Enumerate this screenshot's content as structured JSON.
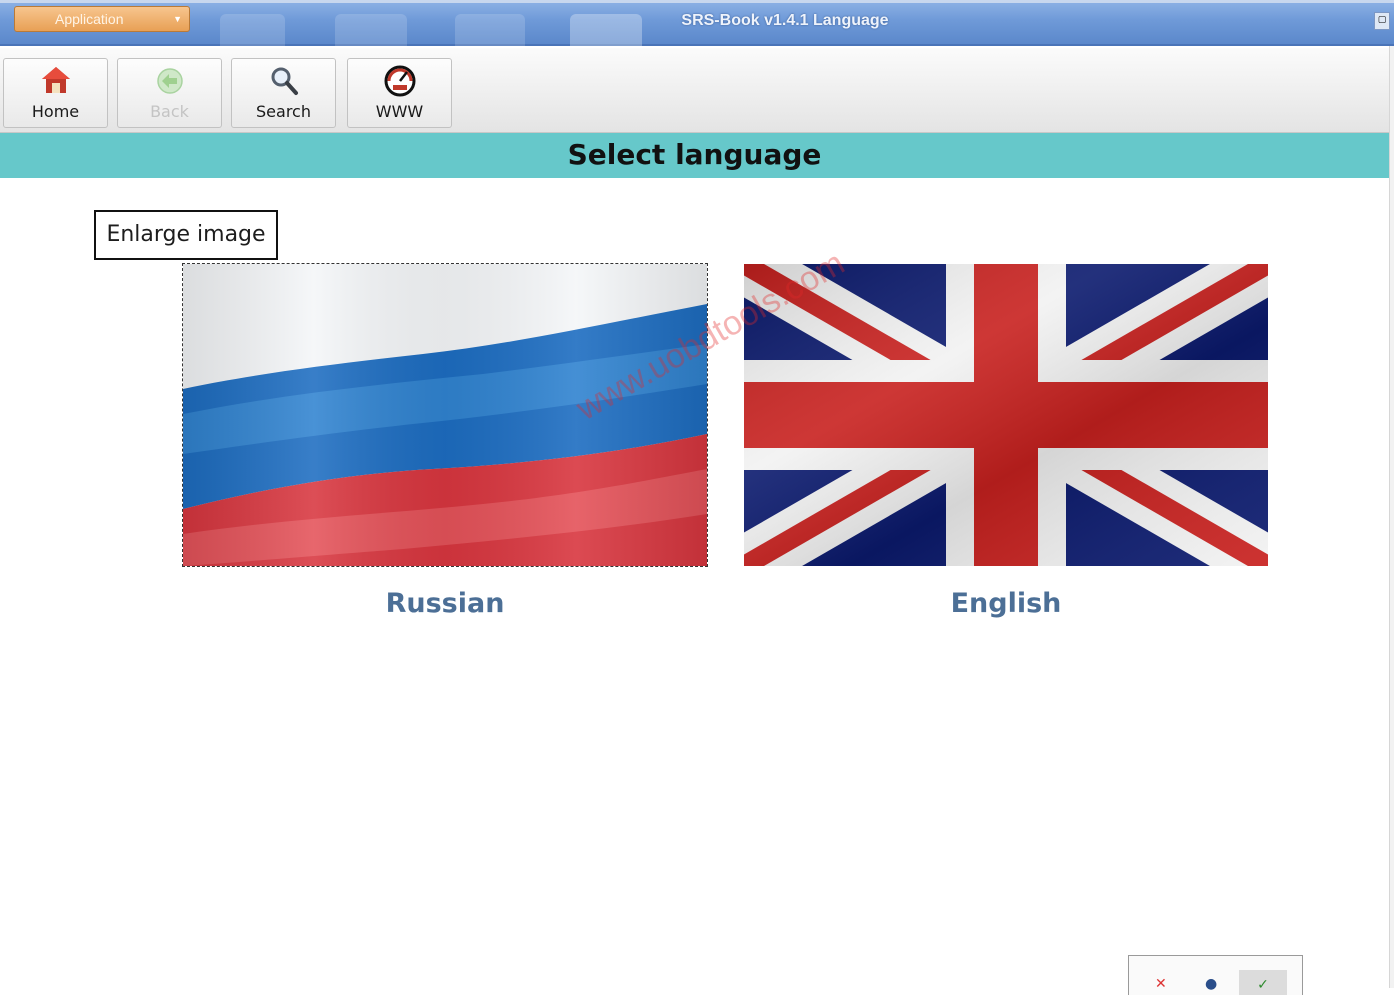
{
  "titlebar": {
    "app_menu_label": "Application",
    "window_title": "SRS-Book v1.4.1 Language"
  },
  "toolbar": {
    "buttons": [
      {
        "label": "Home",
        "icon": "home-icon",
        "enabled": true
      },
      {
        "label": "Back",
        "icon": "back-arrow-icon",
        "enabled": false
      },
      {
        "label": "Search",
        "icon": "magnifier-icon",
        "enabled": true
      },
      {
        "label": "WWW",
        "icon": "speedometer-icon",
        "enabled": true
      }
    ]
  },
  "page": {
    "heading": "Select language",
    "enlarge_label": "Enlarge image"
  },
  "languages": [
    {
      "label": "Russian",
      "flag": "russian-flag",
      "selected": true
    },
    {
      "label": "English",
      "flag": "uk-flag",
      "selected": false
    }
  ],
  "watermark": "www.uobdtools.com",
  "colors": {
    "header_band": "#66c8ca",
    "language_label": "#4c6f96",
    "titlebar": "#6f9ad8"
  }
}
